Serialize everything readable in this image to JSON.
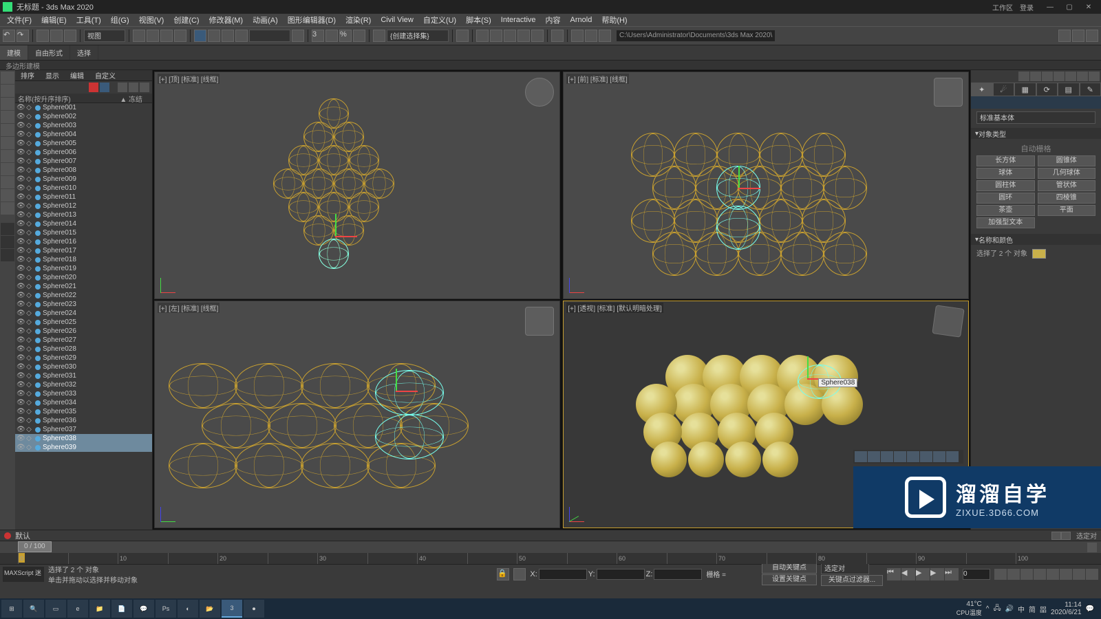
{
  "app": {
    "title": "无标题 - 3ds Max 2020",
    "workspace_label": "工作区",
    "login_label": "登录"
  },
  "menu": [
    "文件(F)",
    "编辑(E)",
    "工具(T)",
    "组(G)",
    "视图(V)",
    "创建(C)",
    "修改器(M)",
    "动画(A)",
    "图形编辑器(D)",
    "渲染(R)",
    "Civil View",
    "自定义(U)",
    "脚本(S)",
    "Interactive",
    "内容",
    "Arnold",
    "帮助(H)"
  ],
  "toolbar": {
    "coord_system": "视图",
    "snap_dd": "",
    "path": "C:\\Users\\Administrator\\Documents\\3ds Max 2020\\"
  },
  "ribbon": {
    "tabs": [
      "建模",
      "自由形式",
      "选择"
    ],
    "subtab": "多边形建模"
  },
  "scene": {
    "tabs": [
      "排序",
      "显示",
      "编辑",
      "自定义"
    ],
    "header_name": "名称(按升序排序)",
    "header_freeze": "▲ 冻结",
    "items": [
      "Sphere001",
      "Sphere002",
      "Sphere003",
      "Sphere004",
      "Sphere005",
      "Sphere006",
      "Sphere007",
      "Sphere008",
      "Sphere009",
      "Sphere010",
      "Sphere011",
      "Sphere012",
      "Sphere013",
      "Sphere014",
      "Sphere015",
      "Sphere016",
      "Sphere017",
      "Sphere018",
      "Sphere019",
      "Sphere020",
      "Sphere021",
      "Sphere022",
      "Sphere023",
      "Sphere024",
      "Sphere025",
      "Sphere026",
      "Sphere027",
      "Sphere028",
      "Sphere029",
      "Sphere030",
      "Sphere031",
      "Sphere032",
      "Sphere033",
      "Sphere034",
      "Sphere035",
      "Sphere036",
      "Sphere037",
      "Sphere038",
      "Sphere039"
    ],
    "selected": [
      37,
      38
    ]
  },
  "viewports": {
    "top": {
      "label": "[+] [顶] [标准] [线框]"
    },
    "front": {
      "label": "[+] [前] [标准] [线框]"
    },
    "left": {
      "label": "[+] [左] [标准] [线框]"
    },
    "persp": {
      "label": "[+] [透视] [标准] [默认明暗处理]",
      "tooltip": "Sphere038"
    }
  },
  "cmd": {
    "rollout_obj_type": "对象类型",
    "rollout_name_color": "名称和颜色",
    "cat_title": "标准基本体",
    "auto_grid": "自动栅格",
    "buttons": [
      [
        "长方体",
        "圆锥体"
      ],
      [
        "球体",
        "几何球体"
      ],
      [
        "圆柱体",
        "管状体"
      ],
      [
        "圆环",
        "四棱锥"
      ],
      [
        "茶壶",
        "平面"
      ],
      [
        "加强型文本",
        ""
      ]
    ],
    "sel_text": "选择了 2 个 对象"
  },
  "time": {
    "handle": "0 / 100",
    "end": "100"
  },
  "status": {
    "left_box": "MAXScript 迷",
    "line1": "选择了 2 个 对象",
    "line2": "单击并拖动以选择并移动对象",
    "x": "",
    "y": "",
    "z": "",
    "grid": "栅格 =",
    "auto_key": "自动关键点",
    "set_key": "设置关键点",
    "filter": "选定对",
    "keyfilter": "关键点过滤器...",
    "tl_default": "默认"
  },
  "watermark": {
    "t1": "溜溜自学",
    "t2": "ZIXUE.3D66.COM"
  },
  "taskbar": {
    "temp": "41°C",
    "temp_sub": "CPU温度",
    "lang": "中",
    "ime": "简",
    "pin": "㗊",
    "time": "11:14",
    "date": "2020/6/21"
  }
}
